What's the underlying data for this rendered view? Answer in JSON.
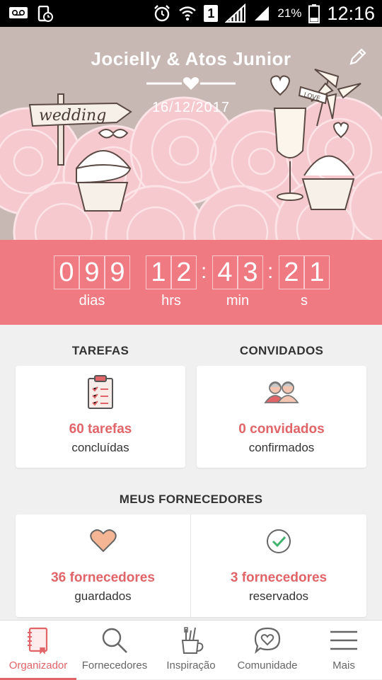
{
  "status_bar": {
    "battery_pct": "21%",
    "time": "12:16",
    "sim_slot": "1"
  },
  "header": {
    "couple": "Jocielly & Atos Junior",
    "date": "16/12/2017",
    "sign_text": "wedding",
    "flag_text": "LOVE"
  },
  "countdown": {
    "days": [
      "0",
      "9",
      "9"
    ],
    "hours": [
      "1",
      "2"
    ],
    "minutes": [
      "4",
      "3"
    ],
    "seconds": [
      "2",
      "1"
    ],
    "labels": {
      "days": "dias",
      "hours": "hrs",
      "minutes": "min",
      "seconds": "s"
    },
    "separator": ":"
  },
  "summary": {
    "tasks": {
      "title": "TAREFAS",
      "main": "60 tarefas",
      "sub": "concluídas"
    },
    "guests": {
      "title": "CONVIDADOS",
      "main": "0 convidados",
      "sub": "confirmados"
    }
  },
  "vendors": {
    "title": "MEUS FORNECEDORES",
    "saved": {
      "main": "36 fornecedores",
      "sub": "guardados"
    },
    "booked": {
      "main": "3 fornecedores",
      "sub": "reservados"
    }
  },
  "nav": [
    {
      "label": "Organizador",
      "icon": "notebook-icon",
      "active": true
    },
    {
      "label": "Fornecedores",
      "icon": "search-icon"
    },
    {
      "label": "Inspiração",
      "icon": "brushes-icon"
    },
    {
      "label": "Comunidade",
      "icon": "chat-heart-icon"
    },
    {
      "label": "Mais",
      "icon": "menu-icon"
    }
  ],
  "colors": {
    "accent": "#e06468",
    "countdown_bg": "#f07a82",
    "header_bg": "#c8b8b4"
  }
}
